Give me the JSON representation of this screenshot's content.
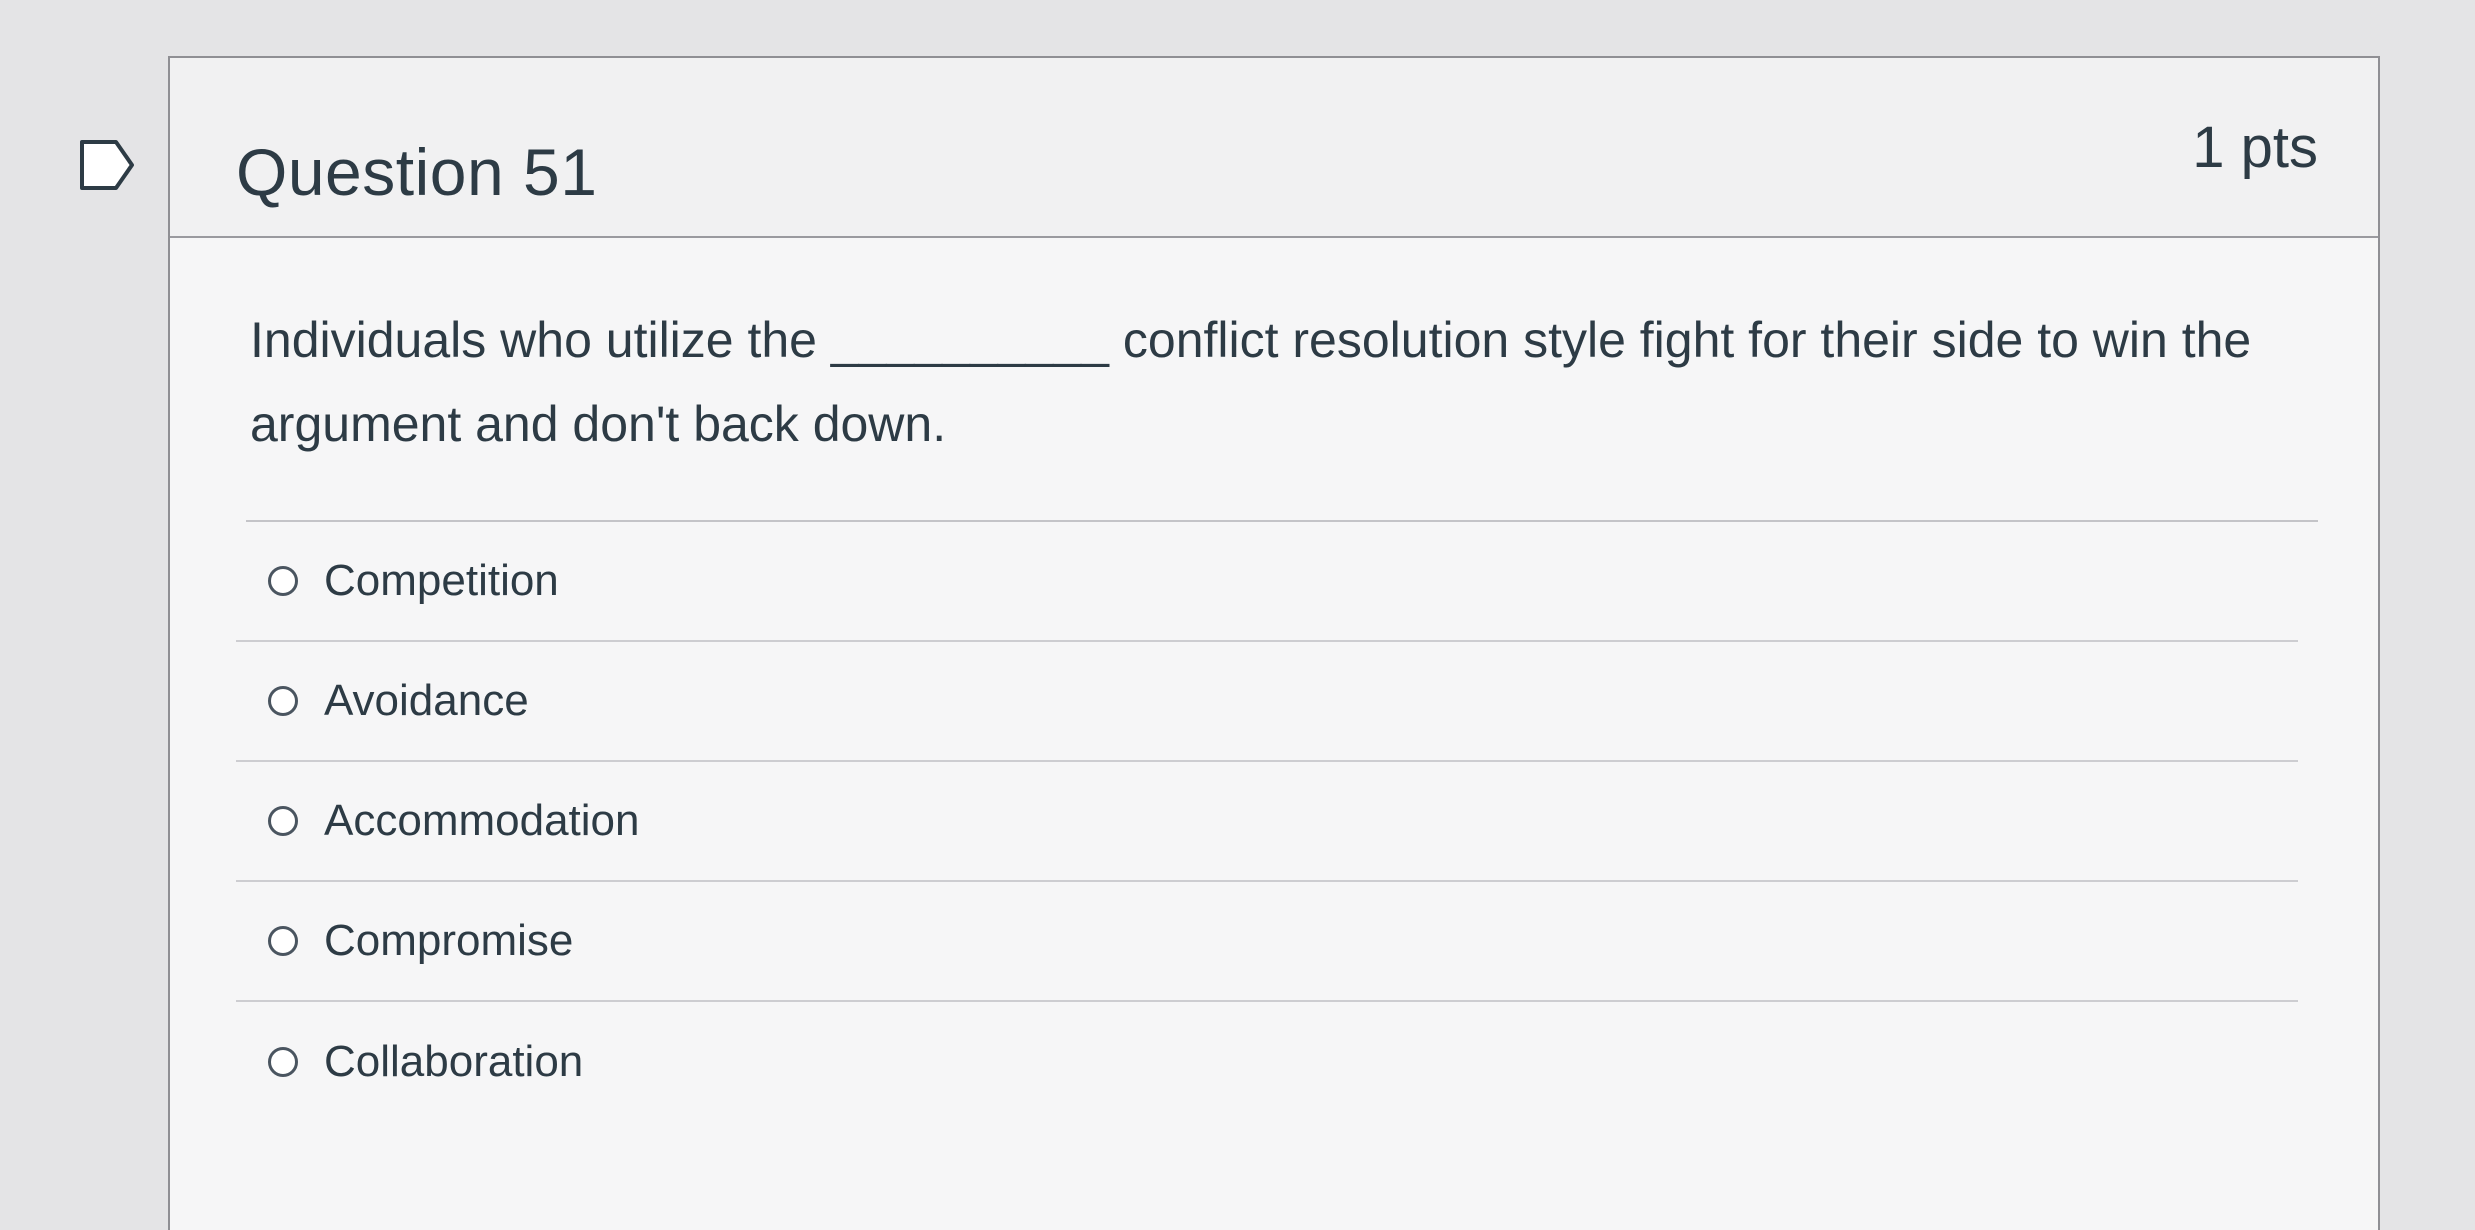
{
  "question": {
    "title": "Question 51",
    "points": "1 pts",
    "flag_icon": "flag-icon",
    "stem_before": "Individuals who utilize the",
    "stem_blank": "__________",
    "stem_after": "conflict resolution style fight for their side to win the argument and don't back down."
  },
  "answers": [
    {
      "label": "Competition",
      "selected": false
    },
    {
      "label": "Avoidance",
      "selected": false
    },
    {
      "label": "Accommodation",
      "selected": false
    },
    {
      "label": "Compromise",
      "selected": false
    },
    {
      "label": "Collaboration",
      "selected": false
    }
  ],
  "colors": {
    "text": "#2d3b45",
    "border": "#8f8f94",
    "background": "#f6f6f7"
  }
}
